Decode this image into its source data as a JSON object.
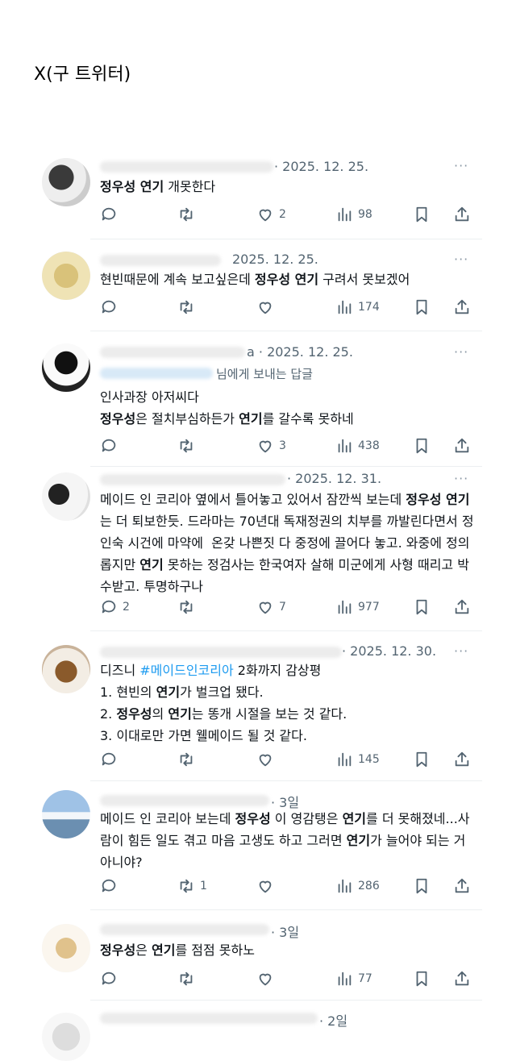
{
  "header": {
    "title": "X(구 트위터)"
  },
  "more_label": "···",
  "tweets": [
    {
      "meta": "· 2025. 12. 25.",
      "text_html": "<b>정우성 연기</b> 개못한다",
      "reply": "",
      "like": "2",
      "views": "98"
    },
    {
      "meta": "2025. 12. 25.",
      "text_html": "현빈때문에 계속 보고싶은데 <b>정우성 연기</b> 구려서 못보겠어",
      "reply": "",
      "like": "",
      "views": "174"
    },
    {
      "meta": "a · 2025. 12. 25.",
      "reply_to_suffix": "님에게 보내는 답글",
      "text_html": "인사과장 아저씨다\n<b>정우성</b>은 절치부심하든가 <b>연기</b>를 갈수록 못하네",
      "reply": "",
      "like": "3",
      "views": "438"
    },
    {
      "meta": "· 2025. 12. 31.",
      "text_html": "메이드 인 코리아 옆에서 틀어놓고 있어서 잠깐씩 보는데 <b>정우성 연기</b>는 더 퇴보한듯. 드라마는 70년대 독재정권의 치부를 까발린다면서 정인숙 시건에 마약에  온갖 나쁜짓 다 중정에 끌어다 놓고. 와중에 정의롭지만 <b>연기</b> 못하는 정검사는 한국여자 살해 미군에게 사형 때리고 박수받고. 투명하구나",
      "reply": "2",
      "like": "7",
      "views": "977"
    },
    {
      "meta": "· 2025. 12. 30.",
      "text_html": "디즈니 <span class=\"hashtag\">#메이드인코리아</span> 2화까지 감상평\n1. 현빈의 <b>연기</b>가 벌크업 됐다.\n2. <b>정우성</b>의 <b>연기</b>는 똥개 시절을 보는 것 같다.\n3. 이대로만 가면 웰메이드 될 것 같다.",
      "reply": "",
      "like": "",
      "views": "145"
    },
    {
      "meta": "· 3일",
      "text_html": "메이드 인 코리아 보는데 <b>정우성</b> 이 영감탱은 <b>연기</b>를 더 못해졌네...사람이 힘든 일도 겪고 마음 고생도 하고 그러면 <b>연기</b>가 늘어야 되는 거 아니야?",
      "reply": "",
      "retweet": "1",
      "like": "",
      "views": "286"
    },
    {
      "meta": "· 3일",
      "text_html": "<b>정우성</b>은 <b>연기</b>를 점점 못하노",
      "reply": "",
      "like": "",
      "views": "77"
    },
    {
      "meta": "· 2일"
    }
  ],
  "icons": [
    "reply-icon",
    "retweet-icon",
    "like-icon",
    "views-icon",
    "bookmark-icon",
    "share-icon"
  ]
}
